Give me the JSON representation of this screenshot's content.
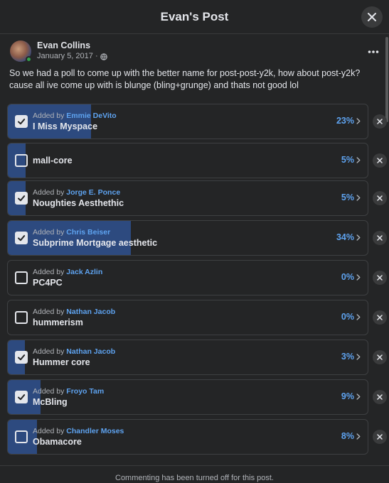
{
  "modal": {
    "title": "Evan's Post"
  },
  "post": {
    "author": "Evan Collins",
    "date": "January 5, 2017 ·",
    "text": "So we had a poll to come up with the better name for post-post-y2k, how about post-y2k? cause all ive come up with is blunge (bling+grunge) and thats not good lol"
  },
  "poll": {
    "added_by_prefix": "Added by",
    "options": [
      {
        "added_by": "Emmie DeVito",
        "label": "I Miss Myspace",
        "percent": "23%",
        "fraction": 0.23,
        "checked": true
      },
      {
        "added_by": "",
        "label": "mall-core",
        "percent": "5%",
        "fraction": 0.05,
        "checked": false
      },
      {
        "added_by": "Jorge E. Ponce",
        "label": "Noughties Aesthethic",
        "percent": "5%",
        "fraction": 0.05,
        "checked": true
      },
      {
        "added_by": "Chris Beiser",
        "label": "Subprime Mortgage aesthetic",
        "percent": "34%",
        "fraction": 0.34,
        "checked": true
      },
      {
        "added_by": "Jack Azlin",
        "label": "PC4PC",
        "percent": "0%",
        "fraction": 0.0,
        "checked": false
      },
      {
        "added_by": "Nathan Jacob",
        "label": "hummerism",
        "percent": "0%",
        "fraction": 0.0,
        "checked": false
      },
      {
        "added_by": "Nathan Jacob",
        "label": "Hummer core",
        "percent": "3%",
        "fraction": 0.03,
        "checked": true
      },
      {
        "added_by": "Froyo Tam",
        "label": "McBling",
        "percent": "9%",
        "fraction": 0.09,
        "checked": true
      },
      {
        "added_by": "Chandler Moses",
        "label": "Obamacore",
        "percent": "8%",
        "fraction": 0.08,
        "checked": false
      }
    ]
  },
  "footer": {
    "text": "Commenting has been turned off for this post."
  },
  "colors": {
    "accent": "#5ea3f0",
    "fill": "#2d4a7f",
    "background": "#242526"
  },
  "icons": {
    "close": "close-icon",
    "more": "more-icon",
    "globe": "globe-icon",
    "check": "check-icon",
    "chevron": "chevron-right-icon",
    "remove": "remove-icon"
  }
}
